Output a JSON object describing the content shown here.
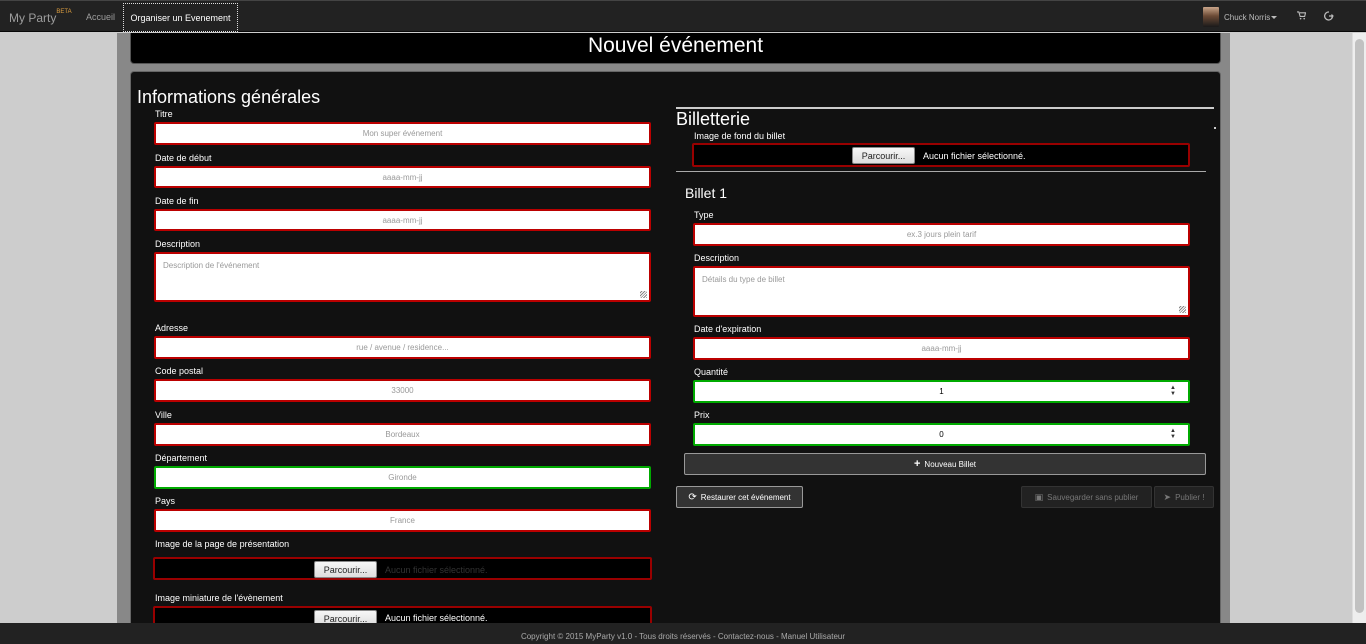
{
  "navbar": {
    "brand": "My Party",
    "brand_badge": "BETA",
    "home": "Accueil",
    "organize": "Organiser un Evenement",
    "user": "Chuck Norris",
    "cart_icon": "cart-icon",
    "logout_icon": "logout-icon"
  },
  "page": {
    "title": "Nouvel événement"
  },
  "general": {
    "heading": "Informations générales",
    "title_label": "Titre",
    "title_placeholder": "Mon super événement",
    "start_label": "Date de début",
    "start_placeholder": "aaaa-mm-jj",
    "end_label": "Date de fin",
    "end_placeholder": "aaaa-mm-jj",
    "desc_label": "Description",
    "desc_placeholder": "Description de l'événement",
    "address_label": "Adresse",
    "address_placeholder": "rue / avenue / residence...",
    "zip_label": "Code postal",
    "zip_placeholder": "33000",
    "city_label": "Ville",
    "city_placeholder": "Bordeaux",
    "dept_label": "Département",
    "dept_placeholder": "Gironde",
    "country_label": "Pays",
    "country_placeholder": "France",
    "cover_label": "Image de la page de présentation",
    "cover_button": "Parcourir...",
    "cover_text": "Aucun fichier sélectionné.",
    "thumb_label": "Image miniature de l'évènement",
    "thumb_button": "Parcourir...",
    "thumb_text": "Aucun fichier sélectionné."
  },
  "ticketing": {
    "heading": "Billetterie",
    "bg_label": "Image de fond du billet",
    "bg_button": "Parcourir...",
    "bg_text": "Aucun fichier sélectionné.",
    "ticket_heading": "Billet 1",
    "type_label": "Type",
    "type_placeholder": "ex.3 jours plein tarif",
    "desc_label": "Description",
    "desc_placeholder": "Détails du type de billet",
    "exp_label": "Date d'expiration",
    "exp_placeholder": "aaaa-mm-jj",
    "qty_label": "Quantité",
    "qty_value": "1",
    "price_label": "Prix",
    "price_value": "0",
    "new_ticket": "Nouveau Billet"
  },
  "actions": {
    "restore": "Restaurer cet événement",
    "save_draft": "Sauvegarder sans publier",
    "publish": "Publier !"
  },
  "footer": {
    "text": "Copyright © 2015 MyParty v1.0 - Tous droits réservés - Contactez-nous - Manuel Utilisateur"
  }
}
